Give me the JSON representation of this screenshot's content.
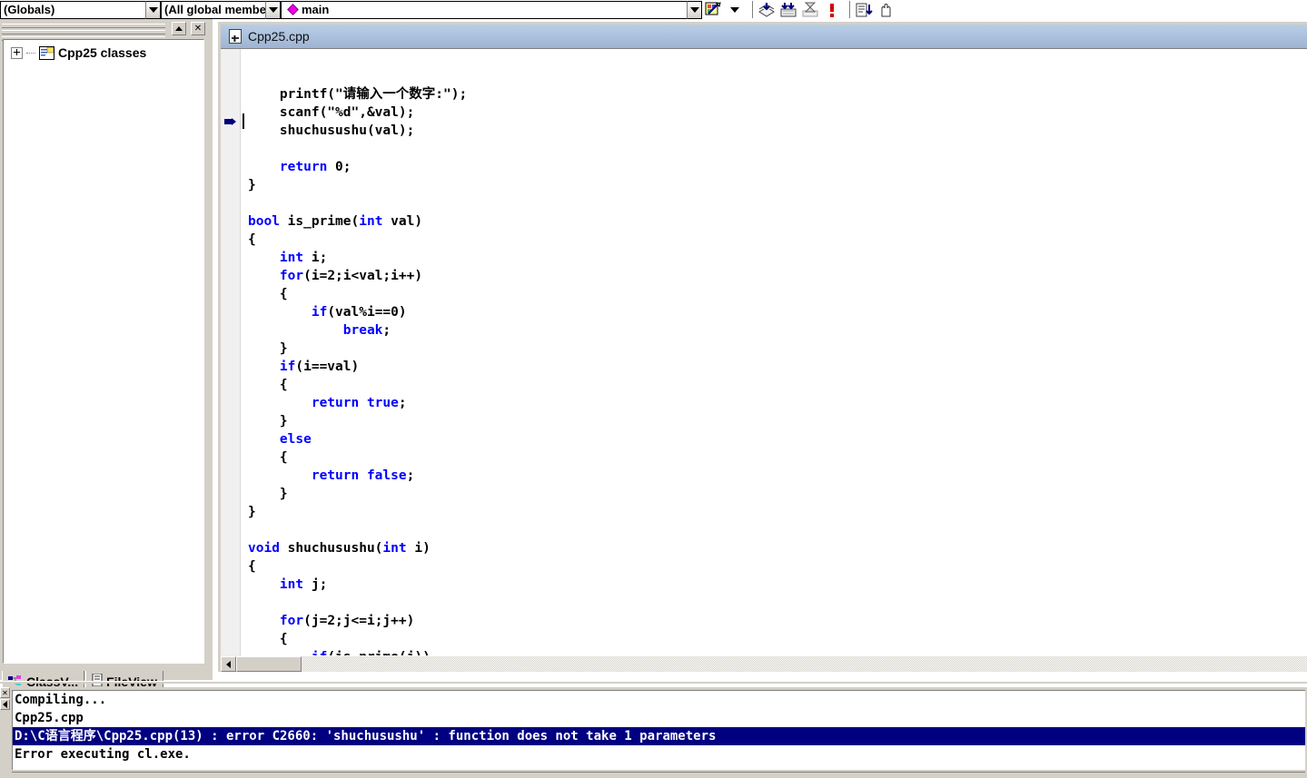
{
  "toolbar": {
    "scope_combo": {
      "value": "(Globals)",
      "icon": "chevron-down-icon"
    },
    "members_combo": {
      "value": "(All global members",
      "icon": "chevron-down-icon"
    },
    "function_combo": {
      "value": "main",
      "icon": "chevron-down-icon",
      "symbol_icon": "magenta-diamond-icon"
    },
    "buttons": [
      {
        "name": "find-in-files-button",
        "icon": "find-icon"
      },
      {
        "name": "find-dropdown-button",
        "icon": "chevron-down-icon"
      },
      {
        "name": "compile-button",
        "icon": "compile-icon"
      },
      {
        "name": "build-button",
        "icon": "build-icon"
      },
      {
        "name": "stop-build-button",
        "icon": "stop-build-icon"
      },
      {
        "name": "execute-program-button",
        "icon": "exclamation-icon"
      },
      {
        "name": "go-button",
        "icon": "go-debug-icon"
      },
      {
        "name": "insert-breakpoint-button",
        "icon": "hand-icon"
      }
    ]
  },
  "workspace": {
    "title_buttons": [
      {
        "name": "workspace-minimize-button",
        "icon": "triangle-up-icon"
      },
      {
        "name": "workspace-close-button",
        "icon": "close-x-icon"
      }
    ],
    "tree": {
      "root": {
        "label": "Cpp25 classes",
        "icon": "class-folder-icon",
        "expander": "plus-box-icon"
      }
    },
    "tabs": [
      {
        "name": "tab-classview",
        "label": "ClassV...",
        "icon": "classview-icon",
        "selected": false
      },
      {
        "name": "tab-fileview",
        "label": "FileView",
        "icon": "fileview-icon",
        "selected": true
      }
    ]
  },
  "editor": {
    "title": "Cpp25.cpp",
    "title_icon": "cpp-file-icon",
    "gutter_marker": "current-statement-arrow-icon",
    "lines": [
      {
        "indent": 0,
        "tokens": []
      },
      {
        "indent": 0,
        "tokens": []
      },
      {
        "indent": 1,
        "tokens": [
          {
            "t": "printf(\"请输入一个数字:\");",
            "c": "plain"
          }
        ]
      },
      {
        "indent": 1,
        "tokens": [
          {
            "t": "scanf(\"%d\",&val);",
            "c": "plain"
          }
        ]
      },
      {
        "indent": 1,
        "tokens": [
          {
            "t": "shuchusushu(val);",
            "c": "plain"
          }
        ]
      },
      {
        "indent": 0,
        "tokens": []
      },
      {
        "indent": 1,
        "tokens": [
          {
            "t": "return",
            "c": "kw"
          },
          {
            "t": " 0;",
            "c": "plain"
          }
        ]
      },
      {
        "indent": 0,
        "tokens": [
          {
            "t": "}",
            "c": "plain"
          }
        ]
      },
      {
        "indent": 0,
        "tokens": []
      },
      {
        "indent": 0,
        "tokens": [
          {
            "t": "bool",
            "c": "kw"
          },
          {
            "t": " is_prime(",
            "c": "plain"
          },
          {
            "t": "int",
            "c": "kw"
          },
          {
            "t": " val)",
            "c": "plain"
          }
        ]
      },
      {
        "indent": 0,
        "tokens": [
          {
            "t": "{",
            "c": "plain"
          }
        ]
      },
      {
        "indent": 1,
        "tokens": [
          {
            "t": "int",
            "c": "kw"
          },
          {
            "t": " i;",
            "c": "plain"
          }
        ]
      },
      {
        "indent": 1,
        "tokens": [
          {
            "t": "for",
            "c": "kw"
          },
          {
            "t": "(i=2;i<val;i++)",
            "c": "plain"
          }
        ]
      },
      {
        "indent": 1,
        "tokens": [
          {
            "t": "{",
            "c": "plain"
          }
        ]
      },
      {
        "indent": 2,
        "tokens": [
          {
            "t": "if",
            "c": "kw"
          },
          {
            "t": "(val%i==0)",
            "c": "plain"
          }
        ]
      },
      {
        "indent": 3,
        "tokens": [
          {
            "t": "break",
            "c": "kw"
          },
          {
            "t": ";",
            "c": "plain"
          }
        ]
      },
      {
        "indent": 1,
        "tokens": [
          {
            "t": "}",
            "c": "plain"
          }
        ]
      },
      {
        "indent": 1,
        "tokens": [
          {
            "t": "if",
            "c": "kw"
          },
          {
            "t": "(i==val)",
            "c": "plain"
          }
        ]
      },
      {
        "indent": 1,
        "tokens": [
          {
            "t": "{",
            "c": "plain"
          }
        ]
      },
      {
        "indent": 2,
        "tokens": [
          {
            "t": "return true",
            "c": "kw"
          },
          {
            "t": ";",
            "c": "plain"
          }
        ]
      },
      {
        "indent": 1,
        "tokens": [
          {
            "t": "}",
            "c": "plain"
          }
        ]
      },
      {
        "indent": 1,
        "tokens": [
          {
            "t": "else",
            "c": "kw"
          }
        ]
      },
      {
        "indent": 1,
        "tokens": [
          {
            "t": "{",
            "c": "plain"
          }
        ]
      },
      {
        "indent": 2,
        "tokens": [
          {
            "t": "return false",
            "c": "kw"
          },
          {
            "t": ";",
            "c": "plain"
          }
        ]
      },
      {
        "indent": 1,
        "tokens": [
          {
            "t": "}",
            "c": "plain"
          }
        ]
      },
      {
        "indent": 0,
        "tokens": [
          {
            "t": "}",
            "c": "plain"
          }
        ]
      },
      {
        "indent": 0,
        "tokens": []
      },
      {
        "indent": 0,
        "tokens": [
          {
            "t": "void",
            "c": "kw"
          },
          {
            "t": " shuchusushu(",
            "c": "plain"
          },
          {
            "t": "int",
            "c": "kw"
          },
          {
            "t": " i)",
            "c": "plain"
          }
        ]
      },
      {
        "indent": 0,
        "tokens": [
          {
            "t": "{",
            "c": "plain"
          }
        ]
      },
      {
        "indent": 1,
        "tokens": [
          {
            "t": "int",
            "c": "kw"
          },
          {
            "t": " j;",
            "c": "plain"
          }
        ]
      },
      {
        "indent": 0,
        "tokens": []
      },
      {
        "indent": 1,
        "tokens": [
          {
            "t": "for",
            "c": "kw"
          },
          {
            "t": "(j=2;j<=i;j++)",
            "c": "plain"
          }
        ]
      },
      {
        "indent": 1,
        "tokens": [
          {
            "t": "{",
            "c": "plain"
          }
        ]
      },
      {
        "indent": 2,
        "tokens": [
          {
            "t": "if",
            "c": "kw"
          },
          {
            "t": "(is_prime(j))",
            "c": "plain"
          }
        ]
      }
    ],
    "hscroll": {
      "left_arrow_icon": "triangle-left-icon"
    }
  },
  "output": {
    "lines": [
      {
        "text": "Compiling...",
        "selected": false
      },
      {
        "text": "Cpp25.cpp",
        "selected": false
      },
      {
        "text": "D:\\C语言程序\\Cpp25.cpp(13) : error C2660: 'shuchusushu' : function does not take 1 parameters",
        "selected": true
      },
      {
        "text": "Error executing cl.exe.",
        "selected": false
      }
    ],
    "side_buttons": [
      {
        "name": "output-close-button",
        "icon": "close-x-icon"
      },
      {
        "name": "output-scroll-button",
        "icon": "triangle-left-icon"
      }
    ]
  },
  "colors": {
    "keyword": "#0000ff",
    "selection": "#000080",
    "marker": "#00007b",
    "chrome": "#d4d0c8",
    "titlebar": "#a8bedb"
  }
}
